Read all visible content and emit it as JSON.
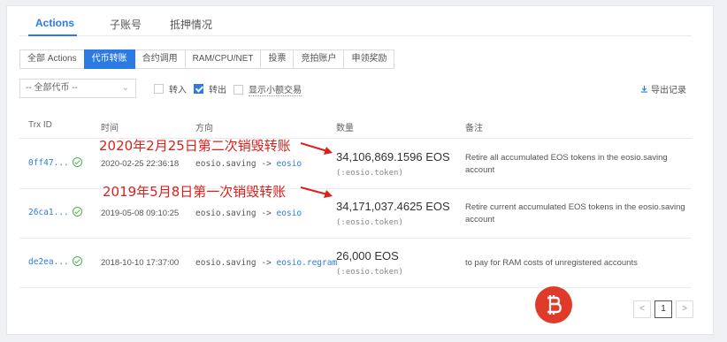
{
  "tabs": [
    {
      "label": "Actions",
      "active": true
    },
    {
      "label": "子账号",
      "active": false
    },
    {
      "label": "抵押情况",
      "active": false
    }
  ],
  "filters": [
    {
      "label": "全部 Actions",
      "active": false
    },
    {
      "label": "代币转账",
      "active": true
    },
    {
      "label": "合约调用",
      "active": false
    },
    {
      "label": "RAM/CPU/NET",
      "active": false
    },
    {
      "label": "投票",
      "active": false
    },
    {
      "label": "竞拍账户",
      "active": false
    },
    {
      "label": "申领奖励",
      "active": false
    }
  ],
  "toolbar": {
    "token_select": "-- 全部代币 --",
    "in_label": "转入",
    "in_checked": false,
    "out_label": "转出",
    "out_checked": true,
    "small_label": "显示小额交易",
    "small_checked": false,
    "export_label": "导出记录"
  },
  "table": {
    "headers": [
      "Trx ID",
      "时间",
      "方向",
      "数量",
      "备注"
    ],
    "rows": [
      {
        "trx_id": "0ff47...",
        "time": "2020-02-25 22:36:18",
        "from": "eosio.saving",
        "arrow": " -> ",
        "to": "eosio",
        "amount": "34,106,869.1596 EOS",
        "token": "(:eosio.token)",
        "memo": "Retire all accumulated EOS tokens in the eosio.saving account"
      },
      {
        "trx_id": "26ca1...",
        "time": "2019-05-08 09:10:25",
        "from": "eosio.saving",
        "arrow": " -> ",
        "to": "eosio",
        "amount": "34,171,037.4625 EOS",
        "token": "(:eosio.token)",
        "memo": "Retire current accumulated EOS tokens in the eosio.saving account"
      },
      {
        "trx_id": "de2ea...",
        "time": "2018-10-10 17:37:00",
        "from": "eosio.saving",
        "arrow": " -> ",
        "to": "eosio.regram",
        "amount": "26,000 EOS",
        "token": "(:eosio.token)",
        "memo": "to pay for RAM costs of unregistered accounts"
      }
    ]
  },
  "annotations": [
    "2020年2月25日第二次销毁转账",
    "2019年5月8日第一次销毁转账"
  ],
  "pagination": {
    "prev": "<",
    "current": "1",
    "next": ">"
  },
  "colors": {
    "accent": "#2c7be5",
    "annotation": "#d9221c",
    "success": "#4caf50",
    "logo": "#e03b2a"
  }
}
